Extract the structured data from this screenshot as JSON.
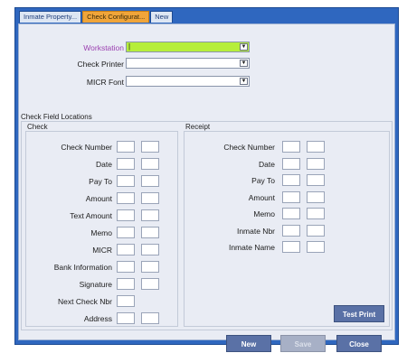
{
  "tabs": [
    {
      "label": "Inmate Property..."
    },
    {
      "label": "Check Configurat..."
    },
    {
      "label": "New"
    }
  ],
  "config": {
    "workstation_label": "Workstation",
    "workstation_value": "|",
    "check_printer_label": "Check Printer",
    "check_printer_value": "",
    "micr_font_label": "MICR Font",
    "micr_font_value": ""
  },
  "field_locations": {
    "title": "Check Field Locations",
    "check": {
      "title": "Check",
      "rows": [
        {
          "label": "Check Number"
        },
        {
          "label": "Date"
        },
        {
          "label": "Pay To"
        },
        {
          "label": "Amount"
        },
        {
          "label": "Text Amount"
        },
        {
          "label": "Memo"
        },
        {
          "label": "MICR"
        },
        {
          "label": "Bank Information"
        },
        {
          "label": "Signature"
        },
        {
          "label": "Next Check Nbr"
        },
        {
          "label": "Address"
        }
      ]
    },
    "receipt": {
      "title": "Receipt",
      "rows": [
        {
          "label": "Check Number"
        },
        {
          "label": "Date"
        },
        {
          "label": "Pay To"
        },
        {
          "label": "Amount"
        },
        {
          "label": "Memo"
        },
        {
          "label": "Inmate Nbr"
        },
        {
          "label": "Inmate Name"
        }
      ]
    },
    "test_print_label": "Test Print"
  },
  "buttons": {
    "new_label": "New",
    "save_label": "Save",
    "close_label": "Close"
  },
  "colors": {
    "frame": "#2f67bf",
    "active_tab": "#f0a53a",
    "highlight_field": "#b6ee3a",
    "button": "#5a71a6"
  }
}
